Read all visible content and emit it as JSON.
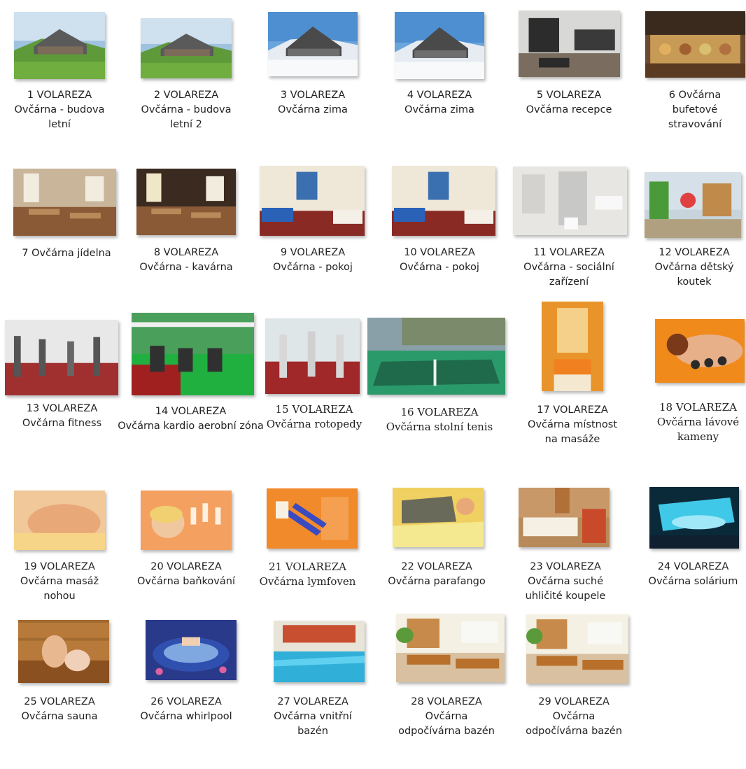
{
  "tiles": [
    {
      "num": "1 VOLAREZA",
      "label": "Ovčárna - budova letní",
      "icon": "building-summer-photo"
    },
    {
      "num": "2 VOLAREZA",
      "label": "Ovčárna - budova letní 2",
      "icon": "building-summer-photo"
    },
    {
      "num": "3 VOLAREZA",
      "label": "Ovčárna zima",
      "icon": "building-winter-photo"
    },
    {
      "num": "4 VOLAREZA",
      "label": "Ovčárna zima",
      "icon": "building-winter-photo"
    },
    {
      "num": "5 VOLAREZA",
      "label": "Ovčárna recepce",
      "icon": "reception-photo"
    },
    {
      "num": "6 Ovčárna",
      "label": "bufetové stravování",
      "icon": "buffet-photo"
    },
    {
      "num": "",
      "label": "7 Ovčárna jídelna",
      "icon": "dining-room-photo"
    },
    {
      "num": "8 VOLAREZA",
      "label": "Ovčárna - kavárna",
      "icon": "cafe-photo"
    },
    {
      "num": "9 VOLAREZA",
      "label": "Ovčárna - pokoj",
      "icon": "room-photo"
    },
    {
      "num": "10 VOLAREZA",
      "label": "Ovčárna - pokoj",
      "icon": "room-photo"
    },
    {
      "num": "11 VOLAREZA",
      "label": "Ovčárna - sociální zařízení",
      "icon": "bathroom-photo"
    },
    {
      "num": "12 VOLAREZA",
      "label": "Ovčárna dětský koutek",
      "icon": "kids-corner-photo"
    },
    {
      "num": "13 VOLAREZA",
      "label": "Ovčárna fitness",
      "icon": "fitness-photo"
    },
    {
      "num": "14 VOLAREZA",
      "label": "Ovčárna kardio aerobní zóna",
      "icon": "cardio-zone-photo"
    },
    {
      "num": "15 VOLAREZA",
      "label": "Ovčárna rotopedy",
      "icon": "exercise-bikes-photo"
    },
    {
      "num": "16 VOLAREZA",
      "label": "Ovčárna stolní tenis",
      "icon": "table-tennis-photo"
    },
    {
      "num": "17 VOLAREZA",
      "label": "Ovčárna místnost na masáže",
      "icon": "massage-room-photo"
    },
    {
      "num": "18 VOLAREZA",
      "label": "Ovčárna lávové kameny",
      "icon": "lava-stones-photo"
    },
    {
      "num": "19 VOLAREZA",
      "label": "Ovčárna masáž nohou",
      "icon": "foot-massage-photo"
    },
    {
      "num": "20 VOLAREZA",
      "label": "Ovčárna baňkování",
      "icon": "cupping-photo"
    },
    {
      "num": "21 VOLAREZA",
      "label": "Ovčárna lymfoven",
      "icon": "lymphatic-photo"
    },
    {
      "num": "22 VOLAREZA",
      "label": "Ovčárna parafango",
      "icon": "parafango-photo"
    },
    {
      "num": "23 VOLAREZA",
      "label": "Ovčárna suché uhličité koupele",
      "icon": "co2-bath-photo"
    },
    {
      "num": "24 VOLAREZA",
      "label": "Ovčárna solárium",
      "icon": "solarium-photo"
    },
    {
      "num": "25 VOLAREZA",
      "label": "Ovčárna sauna",
      "icon": "sauna-photo"
    },
    {
      "num": "26 VOLAREZA",
      "label": "Ovčárna whirlpool",
      "icon": "whirlpool-photo"
    },
    {
      "num": "27 VOLAREZA",
      "label": "Ovčárna vnitřní bazén",
      "icon": "indoor-pool-photo"
    },
    {
      "num": "28 VOLAREZA",
      "label": "Ovčárna odpočívárna bazén",
      "icon": "pool-lounge-photo"
    },
    {
      "num": "29 VOLAREZA",
      "label": "Ovčárna odpočívárna bazén",
      "icon": "pool-lounge-photo"
    }
  ]
}
